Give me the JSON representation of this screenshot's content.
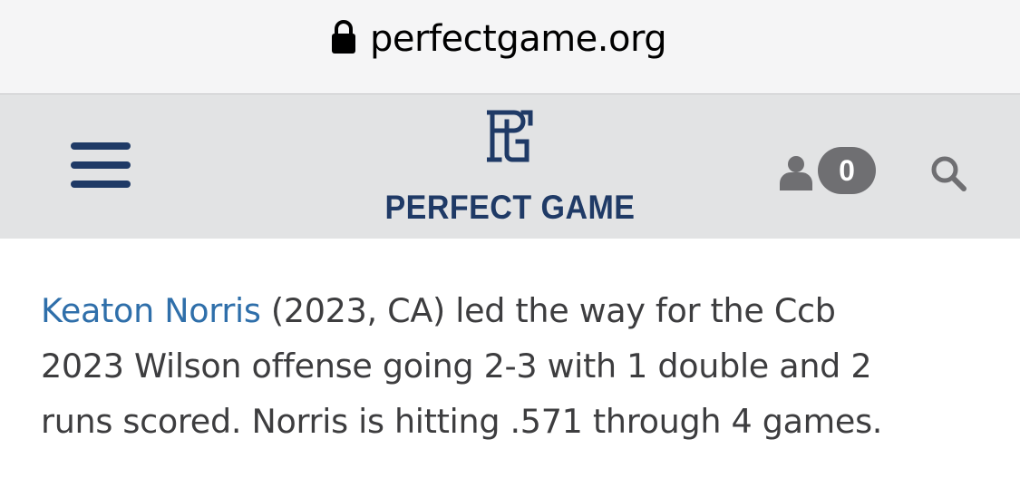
{
  "browser": {
    "url": "perfectgame.org",
    "lock_icon": "lock-icon"
  },
  "header": {
    "menu_icon": "hamburger-menu-icon",
    "logo_mark": "PG",
    "logo_text": "PERFECT GAME",
    "user_icon": "user-icon",
    "cart_count": "0",
    "search_icon": "search-icon",
    "brand_color": "#1f3a66",
    "background_color": "#e2e3e4"
  },
  "article": {
    "player_link": "Keaton Norris",
    "lines": [
      " (2023, CA) led the way for the Ccb",
      "2023 Wilson offense going 2-3 with 1 double and 2",
      "runs scored. Norris is hitting .571 through 4 games."
    ],
    "link_color": "#2f6faa"
  }
}
